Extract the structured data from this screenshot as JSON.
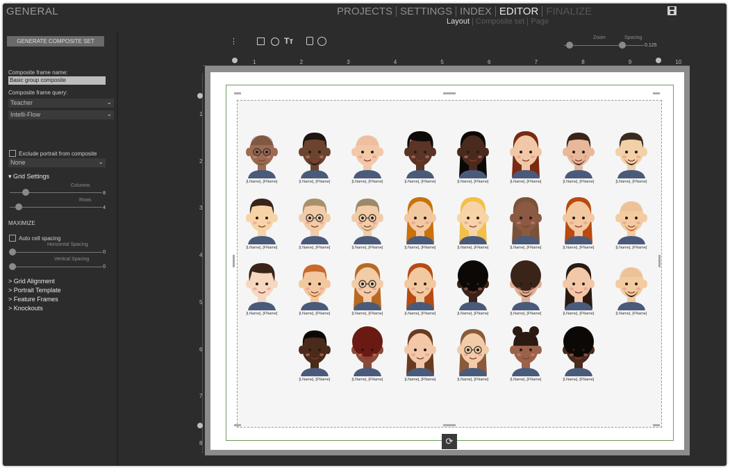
{
  "app": {
    "title": "GENERAL",
    "nav": [
      "PROJECTS",
      "SETTINGS",
      "INDEX",
      "EDITOR",
      "FINALIZE"
    ],
    "subnav": [
      "Layout",
      "Composite set",
      "Page"
    ]
  },
  "sidebar": {
    "generate_button": "GENERATE COMPOSITE SET",
    "frame_name_label": "Composite frame name:",
    "frame_name_value": "Basic group composite",
    "frame_query_label": "Composite frame query:",
    "query_select_1": "Teacher",
    "query_select_2": "Intelli-Flow",
    "exclude_label": "Exclude portrait from composite",
    "exclude_select": "None",
    "grid_settings": "Grid Settings",
    "columns_label": "Columns",
    "columns_value": "8",
    "rows_label": "Rows",
    "rows_value": "4",
    "maximize": "MAXIMIZE",
    "auto_spacing": "Auto cell spacing",
    "hspacing_label": "Horizontal Spacing",
    "hspacing_value": "0",
    "vspacing_label": "Vertical Spacing",
    "vspacing_value": "0",
    "sections": [
      "Grid Alignment",
      "Portrait Template",
      "Feature Frames",
      "Knockouts"
    ]
  },
  "toolbar": {
    "zoom_label": "Zoom",
    "spacing_label": "Spacing",
    "spacing_value": "0.125",
    "icons": [
      "more-vertical-icon",
      "image-icon",
      "frame-icon",
      "text-icon",
      "lock-icon",
      "grid-icon"
    ]
  },
  "ruler": {
    "h": [
      "1",
      "2",
      "3",
      "4",
      "5",
      "6",
      "7",
      "8",
      "9",
      "10"
    ],
    "v": [
      "1",
      "2",
      "3",
      "4",
      "5",
      "6",
      "7",
      "8"
    ]
  },
  "portraits": {
    "label": "[LName], [FName]",
    "rows": [
      [
        {
          "skin": "#9c6b52",
          "hair": "#5a3b2a",
          "style": "bald",
          "glasses": true,
          "beard": "#6a5a3a"
        },
        {
          "skin": "#6b4430",
          "hair": "#1e1410",
          "style": "short",
          "glasses": false,
          "beard": "#1e1410"
        },
        {
          "skin": "#f2c8a8",
          "hair": "#e8b090",
          "style": "bald",
          "glasses": false,
          "beard": ""
        },
        {
          "skin": "#5a3424",
          "hair": "#0e0a08",
          "style": "side",
          "glasses": false,
          "beard": ""
        },
        {
          "skin": "#4a2a1c",
          "hair": "#0c0806",
          "style": "long",
          "glasses": false,
          "beard": ""
        },
        {
          "skin": "#f0c8a8",
          "hair": "#7a2a12",
          "style": "long",
          "glasses": false,
          "beard": ""
        },
        {
          "skin": "#e8b89a",
          "hair": "#3a2418",
          "style": "short",
          "glasses": false,
          "beard": "#3a2418"
        },
        {
          "skin": "#f2d0a8",
          "hair": "#3a2a1e",
          "style": "short",
          "glasses": false,
          "beard": "#3a2a1e"
        }
      ],
      [
        {
          "skin": "#f6d4a8",
          "hair": "#3a2418",
          "style": "short",
          "glasses": false,
          "beard": ""
        },
        {
          "skin": "#f2cca8",
          "hair": "#a8906a",
          "style": "short",
          "glasses": true,
          "beard": ""
        },
        {
          "skin": "#f2cca8",
          "hair": "#9a8a6a",
          "style": "short",
          "glasses": true,
          "beard": "#9a8a6a"
        },
        {
          "skin": "#f2c8a0",
          "hair": "#c8720a",
          "style": "long",
          "glasses": false,
          "beard": ""
        },
        {
          "skin": "#f6d4a8",
          "hair": "#f2c048",
          "style": "long",
          "glasses": false,
          "beard": ""
        },
        {
          "skin": "#8a5a42",
          "hair": "#7a5238",
          "style": "long",
          "glasses": false,
          "beard": ""
        },
        {
          "skin": "#f2c8a0",
          "hair": "#b84a12",
          "style": "long",
          "glasses": false,
          "beard": ""
        },
        {
          "skin": "#f2cca0",
          "hair": "#e8b48a",
          "style": "bald",
          "glasses": false,
          "beard": "#c8621a"
        }
      ],
      [
        {
          "skin": "#f6d8c0",
          "hair": "#3a2418",
          "style": "side",
          "glasses": false,
          "beard": ""
        },
        {
          "skin": "#f2c8a0",
          "hair": "#c86a2a",
          "style": "short",
          "glasses": false,
          "beard": "#c86a2a"
        },
        {
          "skin": "#f2cca8",
          "hair": "#b86a20",
          "style": "long",
          "glasses": true,
          "beard": ""
        },
        {
          "skin": "#f2c8a0",
          "hair": "#b84a12",
          "style": "long",
          "glasses": false,
          "beard": ""
        },
        {
          "skin": "#3a2418",
          "hair": "#0c0806",
          "style": "curly",
          "glasses": false,
          "beard": ""
        },
        {
          "skin": "#e0b094",
          "hair": "#3a2418",
          "style": "curly",
          "glasses": false,
          "beard": "#3a2418"
        },
        {
          "skin": "#f2c8a8",
          "hair": "#2a1a12",
          "style": "long",
          "glasses": false,
          "beard": ""
        },
        {
          "skin": "#f2cca0",
          "hair": "#e8b48a",
          "style": "bald",
          "glasses": false,
          "beard": "#2a1a12"
        }
      ],
      [
        {
          "skin": "#4a2a1a",
          "hair": "#0c0806",
          "style": "short",
          "glasses": false,
          "beard": ""
        },
        {
          "skin": "#8a4a3a",
          "hair": "#6a1a12",
          "style": "curly",
          "glasses": false,
          "beard": ""
        },
        {
          "skin": "#f2c8a8",
          "hair": "#6a3a20",
          "style": "long",
          "glasses": false,
          "beard": ""
        },
        {
          "skin": "#f2cca8",
          "hair": "#8a5a3a",
          "style": "long",
          "glasses": true,
          "beard": ""
        },
        {
          "skin": "#9a6248",
          "hair": "#2a1a12",
          "style": "buns",
          "glasses": false,
          "beard": ""
        },
        {
          "skin": "#4a2a1a",
          "hair": "#0c0806",
          "style": "curly",
          "glasses": false,
          "beard": ""
        }
      ]
    ]
  }
}
